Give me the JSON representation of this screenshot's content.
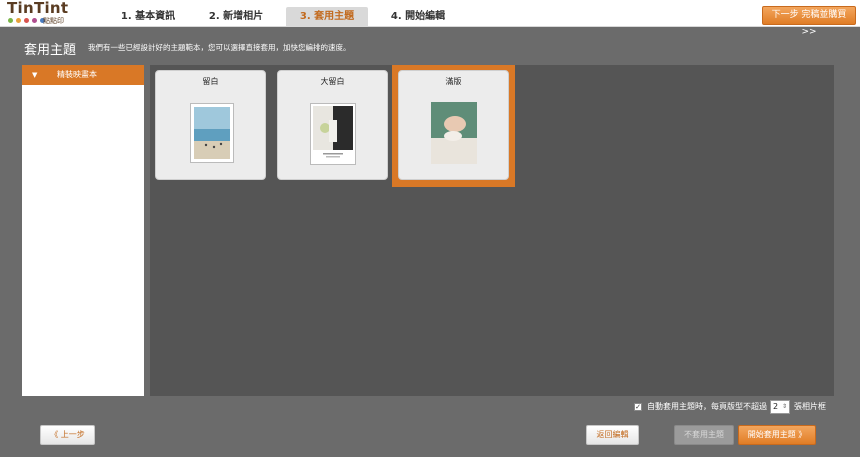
{
  "app": {
    "logo_text": "TinTint",
    "logo_sub": "點點印"
  },
  "steps": [
    {
      "label": "1. 基本資訊"
    },
    {
      "label": "2. 新增相片"
    },
    {
      "label": "3. 套用主題"
    },
    {
      "label": "4. 開始編輯"
    }
  ],
  "header": {
    "next_button": "下一步 完稿並購買 >>",
    "title": "套用主題",
    "description": "我們有一些已經設計好的主題範本，您可以選擇直接套用，加快您編排的速度。"
  },
  "sidebar": {
    "items": [
      {
        "label": "精裝映畫本",
        "arrow": "▼"
      }
    ]
  },
  "themes": [
    {
      "title": "留白",
      "selected": false
    },
    {
      "title": "大留白",
      "selected": false
    },
    {
      "title": "滿版",
      "selected": true
    }
  ],
  "auto_apply": {
    "checked_mark": "✓",
    "label": "自動套用主題時，每頁版型不超過",
    "count": "2",
    "suffix": "張相片框"
  },
  "footer": {
    "prev_button": "《 上一步",
    "back_button": "返回編輯",
    "no_theme_button": "不套用主題",
    "apply_button": "開始套用主題 》"
  },
  "colors": {
    "accent": "#d97826",
    "background": "#6b6b6b",
    "panel": "#555555"
  }
}
